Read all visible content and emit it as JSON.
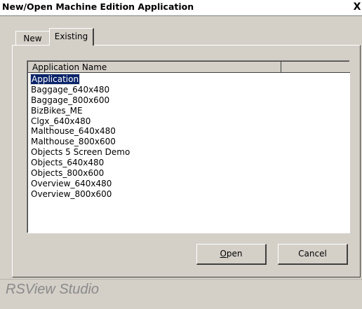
{
  "window": {
    "title": "New/Open Machine Edition Application",
    "close_glyph": "X"
  },
  "tabs": [
    {
      "label": "New",
      "active": false
    },
    {
      "label": "Existing",
      "active": true
    }
  ],
  "list": {
    "columns": [
      "Application Name",
      ""
    ],
    "selected_index": 0,
    "items": [
      "Application",
      "Baggage_640x480",
      "Baggage_800x600",
      "BizBikes_ME",
      "Clgx_640x480",
      "Malthouse_640x480",
      "Malthouse_800x600",
      "Objects 5 Screen Demo",
      "Objects_640x480",
      "Objects_800x600",
      "Overview_640x480",
      "Overview_800x600"
    ]
  },
  "buttons": {
    "open": {
      "accel": "O",
      "rest": "pen"
    },
    "cancel": "Cancel"
  },
  "footer": {
    "brand": "RSView Studio"
  },
  "colors": {
    "face": "#d4d0c8",
    "selection": "#0a246a",
    "brand_text": "#8a8a8a"
  }
}
